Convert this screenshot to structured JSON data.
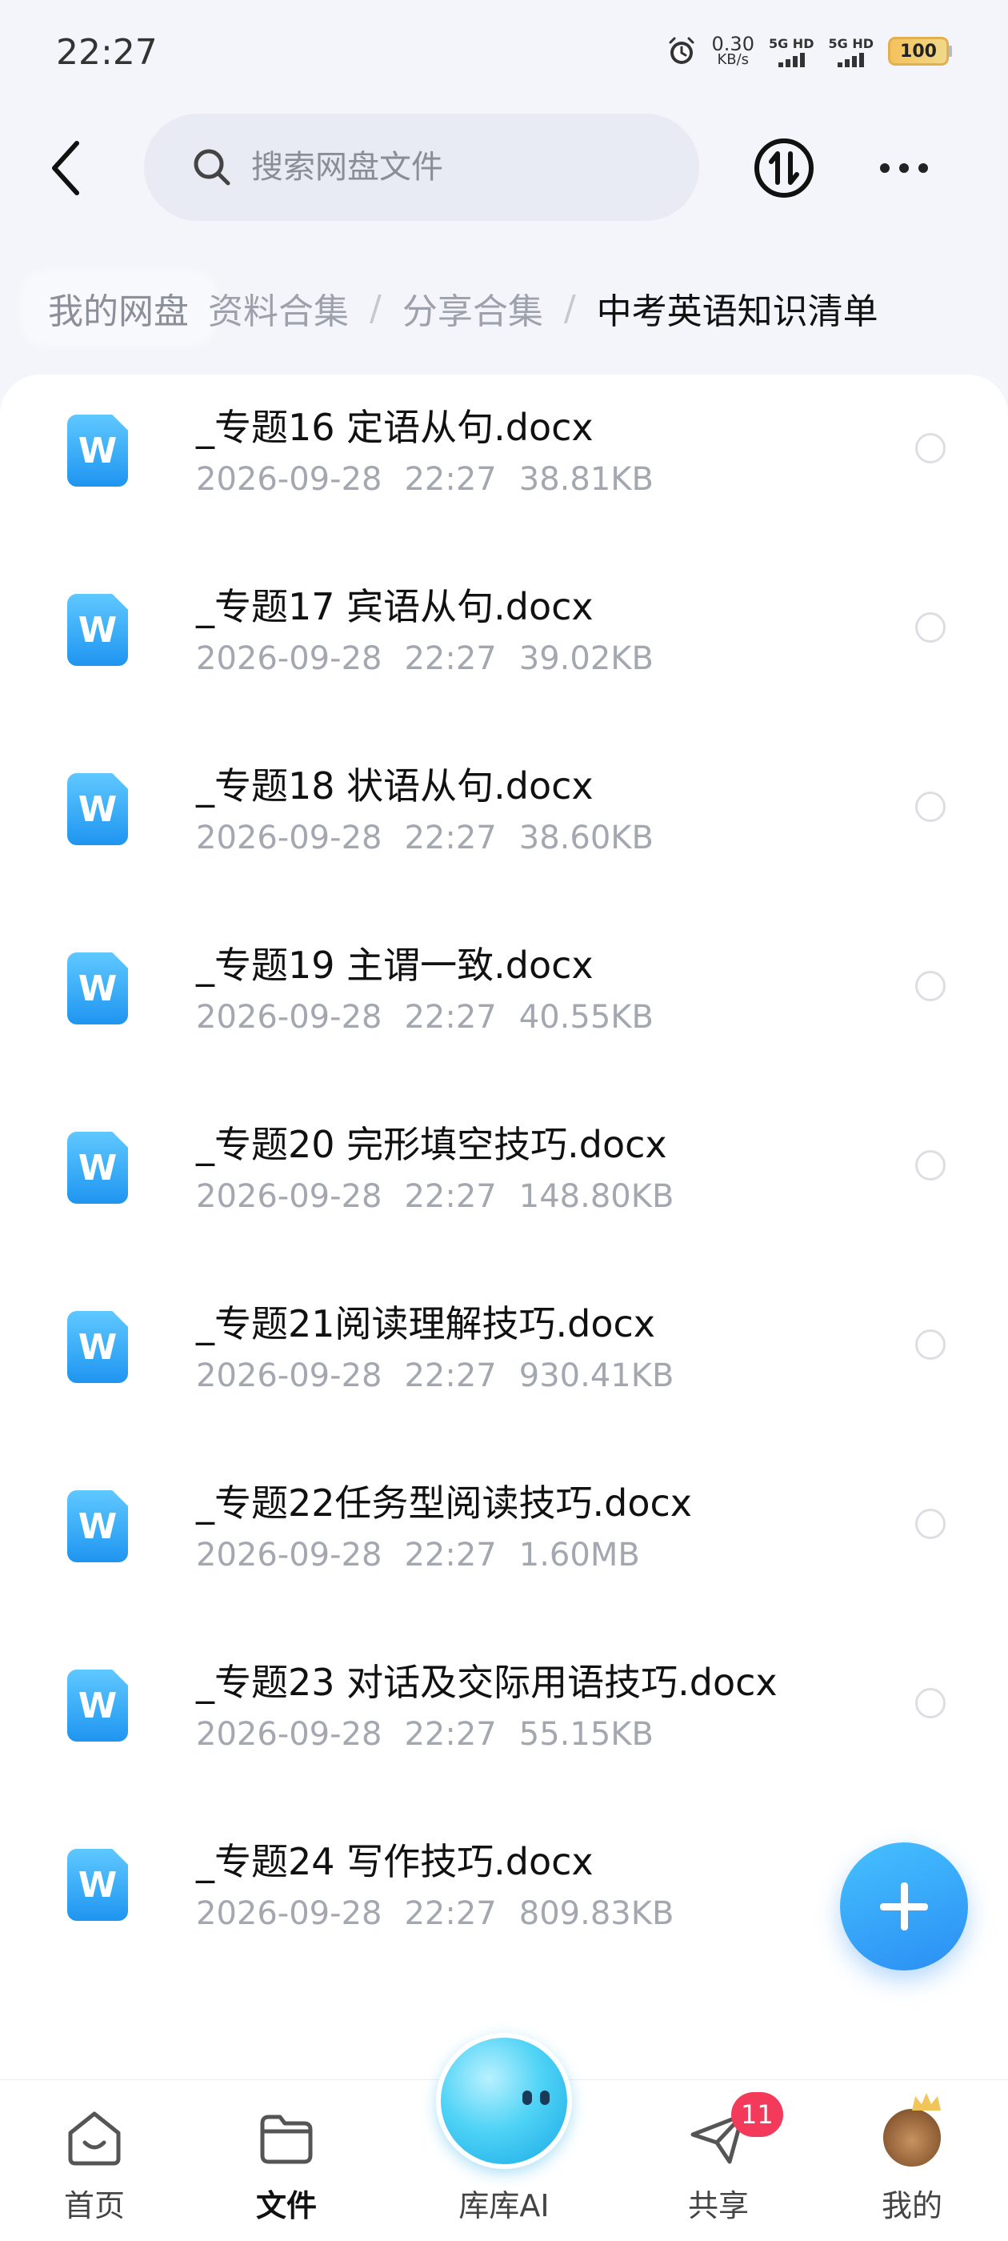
{
  "status_bar": {
    "time": "22:27",
    "net_speed_value": "0.30",
    "net_speed_unit": "KB/s",
    "sim1_label": "5G HD",
    "sim2_label": "5G HD",
    "battery": "100"
  },
  "header": {
    "search_placeholder": "搜索网盘文件"
  },
  "breadcrumb": {
    "root": "我的网盘",
    "partial": "资料合集",
    "middle": "分享合集",
    "current": "中考英语知识清单",
    "separator": "/"
  },
  "files": [
    {
      "name": "_专题16 定语从句.docx",
      "date": "2026-09-28",
      "time": "22:27",
      "size": "38.81KB",
      "icon_letter": "W"
    },
    {
      "name": "_专题17 宾语从句.docx",
      "date": "2026-09-28",
      "time": "22:27",
      "size": "39.02KB",
      "icon_letter": "W"
    },
    {
      "name": "_专题18 状语从句.docx",
      "date": "2026-09-28",
      "time": "22:27",
      "size": "38.60KB",
      "icon_letter": "W"
    },
    {
      "name": "_专题19 主谓一致.docx",
      "date": "2026-09-28",
      "time": "22:27",
      "size": "40.55KB",
      "icon_letter": "W"
    },
    {
      "name": "_专题20 完形填空技巧.docx",
      "date": "2026-09-28",
      "time": "22:27",
      "size": "148.80KB",
      "icon_letter": "W"
    },
    {
      "name": "_专题21阅读理解技巧.docx",
      "date": "2026-09-28",
      "time": "22:27",
      "size": "930.41KB",
      "icon_letter": "W"
    },
    {
      "name": "_专题22任务型阅读技巧.docx",
      "date": "2026-09-28",
      "time": "22:27",
      "size": "1.60MB",
      "icon_letter": "W"
    },
    {
      "name": "_专题23 对话及交际用语技巧.docx",
      "date": "2026-09-28",
      "time": "22:27",
      "size": "55.15KB",
      "icon_letter": "W"
    },
    {
      "name": "_专题24 写作技巧.docx",
      "date": "2026-09-28",
      "time": "22:27",
      "size": "809.83KB",
      "icon_letter": "W"
    }
  ],
  "bottom_nav": {
    "home": "首页",
    "files": "文件",
    "ai": "库库AI",
    "share": "共享",
    "me": "我的",
    "share_badge": "11"
  },
  "colors": {
    "accent": "#2a8ef3",
    "badge": "#f33a5a",
    "word_icon": "#1f95f0"
  }
}
